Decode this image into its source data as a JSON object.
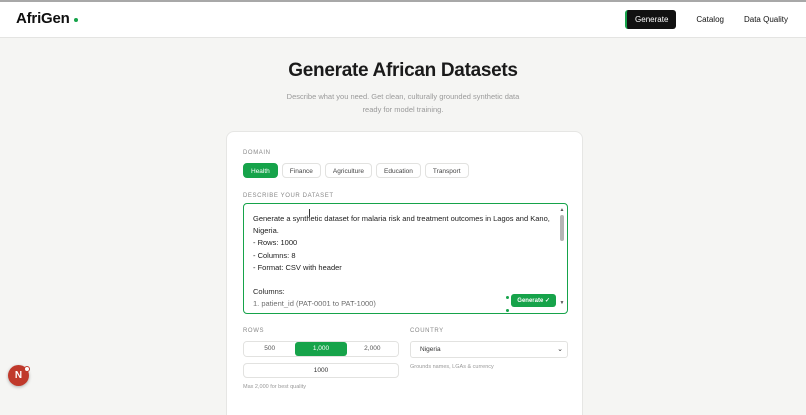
{
  "brand": {
    "name": "AfriGen"
  },
  "nav": {
    "items": [
      "Generate",
      "Catalog",
      "Data Quality"
    ]
  },
  "hero": {
    "title": "Generate African Datasets",
    "subtitle_line1": "Describe what you need. Get clean, culturally grounded synthetic data",
    "subtitle_line2": "ready for model training."
  },
  "domain": {
    "label": "DOMAIN",
    "options": [
      "Health",
      "Finance",
      "Agriculture",
      "Education",
      "Transport"
    ],
    "selected": "Health"
  },
  "describe": {
    "label": "DESCRIBE YOUR DATASET",
    "value": "Generate a synthetic dataset for malaria risk and treatment outcomes in Lagos and Kano, Nigeria.\n- Rows: 1000\n- Columns: 8\n- Format: CSV with header\n\nColumns:\n1. patient_id (PAT-0001 to PAT-1000)",
    "generate_label": "Generate ✓"
  },
  "rows": {
    "label": "ROWS",
    "options": [
      "500",
      "1,000",
      "2,000"
    ],
    "selected": "1,000",
    "input_value": "1000",
    "hint": "Max 2,000 for best quality"
  },
  "country": {
    "label": "COUNTRY",
    "selected": "Nigeria",
    "hint": "Grounds names, LGAs & currency"
  },
  "badge": {
    "letter": "N"
  },
  "colors": {
    "accent": "#16a34a",
    "dark": "#111111",
    "badge": "#c0392b"
  }
}
